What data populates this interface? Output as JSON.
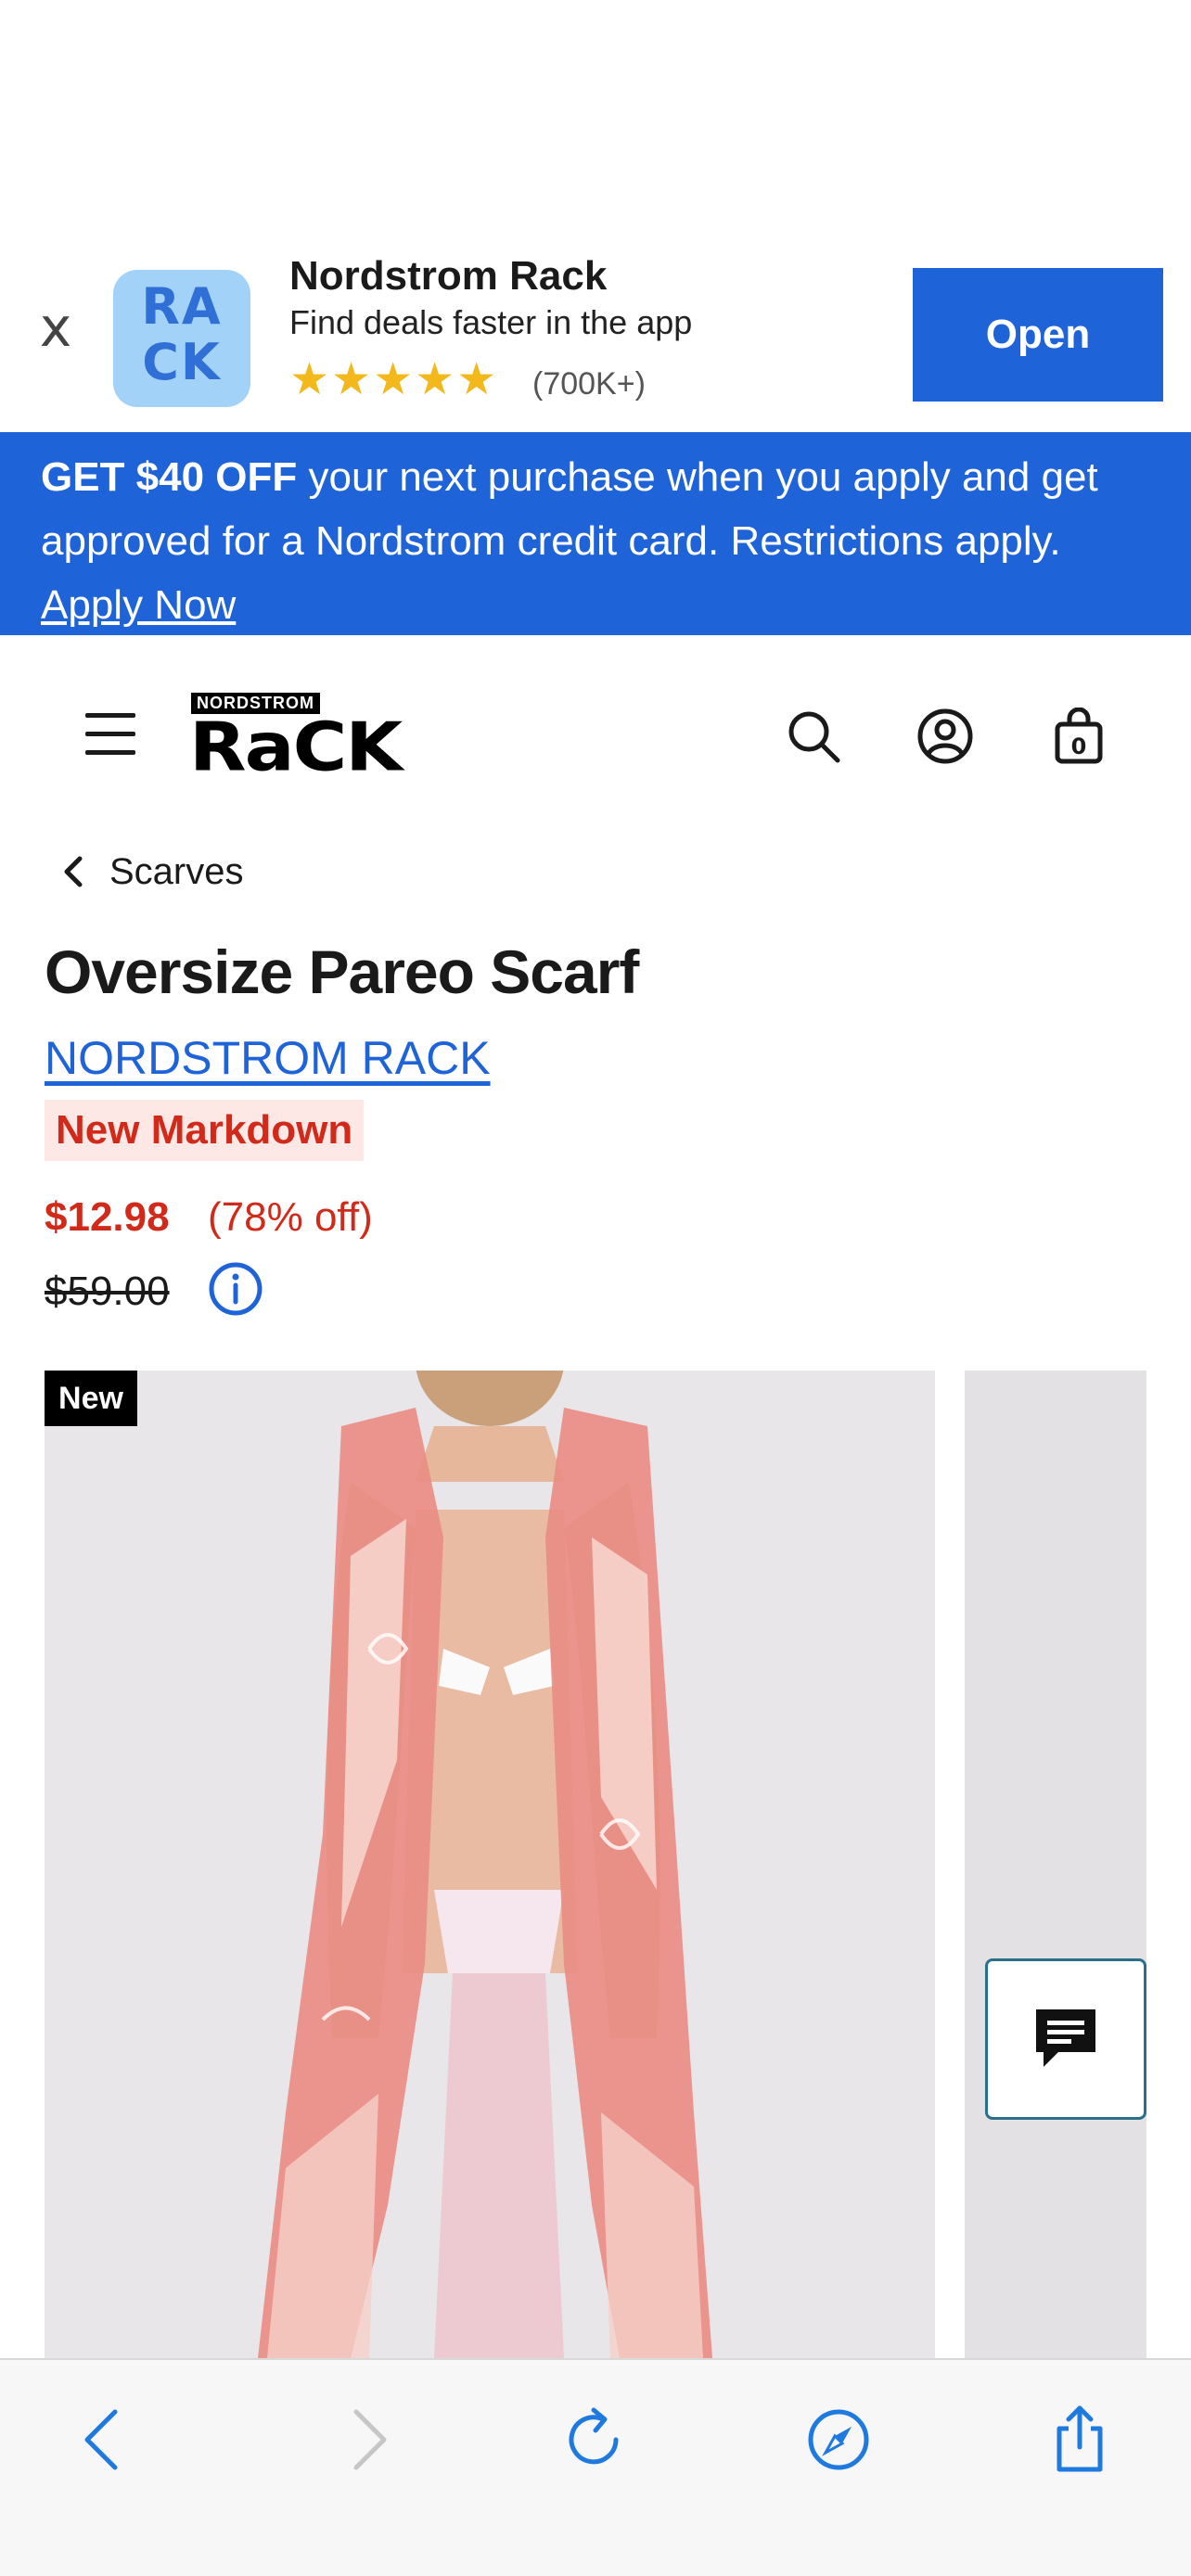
{
  "app_banner": {
    "close_label": "x",
    "app_name": "Nordstrom Rack",
    "tagline": "Find deals faster in the app",
    "stars": "★★★★★",
    "reviews": "(700K+)",
    "open_label": "Open",
    "icon_text_top": "RA",
    "icon_text_bottom": "CK"
  },
  "promo": {
    "bold": "GET $40 OFF",
    "text": " your next purchase when you apply and get approved for a Nordstrom credit card. Restrictions apply. ",
    "link": "Apply Now"
  },
  "header": {
    "logo_small": "NORDSTROM",
    "logo_big": "RaCK"
  },
  "breadcrumb": {
    "label": "Scarves"
  },
  "product": {
    "title": "Oversize Pareo Scarf",
    "brand": "NORDSTROM RACK",
    "badge": "New Markdown",
    "price": "$12.98",
    "discount": "(78% off)",
    "original_price": "$59.00"
  },
  "gallery": {
    "new_badge": "New"
  },
  "colors": {
    "accent_blue": "#1f63d9",
    "sale_red": "#d12a1a",
    "star_gold": "#f2b81c"
  }
}
